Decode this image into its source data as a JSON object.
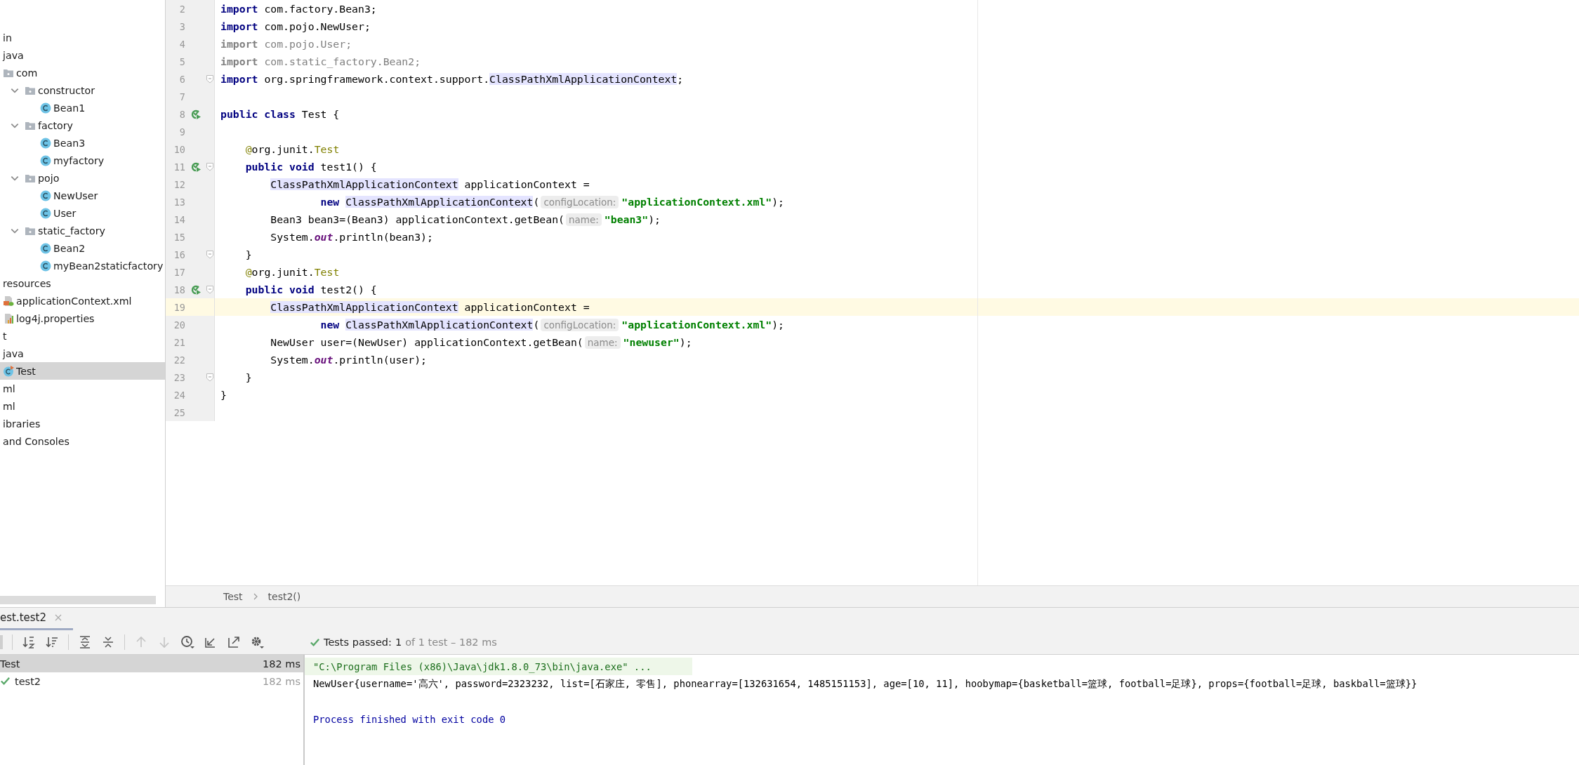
{
  "project_tree": [
    {
      "label": "in",
      "kind": "none",
      "selected": false
    },
    {
      "label": "java",
      "kind": "none",
      "selected": false
    },
    {
      "label": "com",
      "kind": "folder",
      "selected": false,
      "children": [
        {
          "label": "constructor",
          "kind": "folder",
          "selected": false,
          "expanded": true,
          "children": [
            {
              "label": "Bean1",
              "kind": "class",
              "selected": false
            }
          ]
        },
        {
          "label": "factory",
          "kind": "folder",
          "selected": false,
          "expanded": true,
          "children": [
            {
              "label": "Bean3",
              "kind": "class",
              "selected": false
            },
            {
              "label": "myfactory",
              "kind": "class",
              "selected": false
            }
          ]
        },
        {
          "label": "pojo",
          "kind": "folder",
          "selected": false,
          "expanded": true,
          "children": [
            {
              "label": "NewUser",
              "kind": "class",
              "selected": false
            },
            {
              "label": "User",
              "kind": "class",
              "selected": false
            }
          ]
        },
        {
          "label": "static_factory",
          "kind": "folder",
          "selected": false,
          "expanded": true,
          "children": [
            {
              "label": "Bean2",
              "kind": "class",
              "selected": false
            },
            {
              "label": "myBean2staticfactory",
              "kind": "class",
              "selected": false
            }
          ]
        }
      ]
    },
    {
      "label": "resources",
      "kind": "none",
      "selected": false
    },
    {
      "label": "applicationContext.xml",
      "kind": "xml",
      "selected": false
    },
    {
      "label": "log4j.properties",
      "kind": "properties",
      "selected": false
    },
    {
      "label": "t",
      "kind": "none",
      "selected": false
    },
    {
      "label": "java",
      "kind": "none",
      "selected": false
    },
    {
      "label": "Test",
      "kind": "test",
      "selected": true
    },
    {
      "label": "ml",
      "kind": "none",
      "selected": false
    },
    {
      "label": "ml",
      "kind": "none",
      "selected": false
    },
    {
      "label": "ibraries",
      "kind": "none",
      "selected": false
    },
    {
      "label": "and Consoles",
      "kind": "none",
      "selected": false
    }
  ],
  "editor": {
    "lines": [
      {
        "number": "2",
        "current": false,
        "run": false,
        "fold": false,
        "tokens": [
          {
            "kind": "keyword",
            "text": "import"
          },
          {
            "kind": "plain",
            "text": " com.factory.Bean3;"
          }
        ]
      },
      {
        "number": "3",
        "current": false,
        "run": false,
        "fold": false,
        "tokens": [
          {
            "kind": "keyword",
            "text": "import"
          },
          {
            "kind": "plain",
            "text": " com.pojo.NewUser;"
          }
        ]
      },
      {
        "number": "4",
        "current": false,
        "run": false,
        "fold": false,
        "tokens": [
          {
            "kind": "unused_keyword",
            "text": "import"
          },
          {
            "kind": "unused",
            "text": " com.pojo.User;"
          }
        ]
      },
      {
        "number": "5",
        "current": false,
        "run": false,
        "fold": false,
        "tokens": [
          {
            "kind": "unused_keyword",
            "text": "import"
          },
          {
            "kind": "unused",
            "text": " com.static_factory.Bean2;"
          }
        ]
      },
      {
        "number": "6",
        "current": false,
        "run": false,
        "fold": true,
        "tokens": [
          {
            "kind": "keyword",
            "text": "import"
          },
          {
            "kind": "plain",
            "text": " org.springframework.context.support."
          },
          {
            "kind": "ref",
            "text": "ClassPathXmlApplicationContext"
          },
          {
            "kind": "plain",
            "text": ";"
          }
        ]
      },
      {
        "number": "7",
        "current": false,
        "run": false,
        "fold": false
      },
      {
        "number": "8",
        "current": false,
        "run": true,
        "fold": false,
        "tokens": [
          {
            "kind": "keyword",
            "text": "public class"
          },
          {
            "kind": "plain",
            "text": " Test {"
          }
        ]
      },
      {
        "number": "9",
        "current": false,
        "run": false,
        "fold": false
      },
      {
        "number": "10",
        "current": false,
        "run": false,
        "fold": false,
        "tokens": [
          {
            "kind": "annotation",
            "text": "    @"
          },
          {
            "kind": "plain",
            "text": "org.junit."
          },
          {
            "kind": "annotation",
            "text": "Test"
          }
        ]
      },
      {
        "number": "11",
        "current": false,
        "run": true,
        "fold": true,
        "tokens": [
          {
            "kind": "keyword",
            "text": "    public void"
          },
          {
            "kind": "plain",
            "text": " test1() {"
          }
        ]
      },
      {
        "number": "12",
        "current": false,
        "run": false,
        "fold": false,
        "tokens": [
          {
            "kind": "ref",
            "text": "        ClassPathXmlApplicationContext"
          },
          {
            "kind": "plain",
            "text": " applicationContext ="
          }
        ]
      },
      {
        "number": "13",
        "current": false,
        "run": false,
        "fold": false,
        "tokens": [
          {
            "kind": "keyword",
            "text": "                new "
          },
          {
            "kind": "ref",
            "text": "ClassPathXmlApplicationContext"
          },
          {
            "kind": "plain",
            "text": "("
          },
          {
            "kind": "hint",
            "text": "configLocation:"
          },
          {
            "kind": "string",
            "text": "\"applicationContext.xml\""
          },
          {
            "kind": "plain",
            "text": ");"
          }
        ]
      },
      {
        "number": "14",
        "current": false,
        "run": false,
        "fold": false,
        "tokens": [
          {
            "kind": "plain",
            "text": "        Bean3 bean3=(Bean3) applicationContext.getBean("
          },
          {
            "kind": "hint",
            "text": "name:"
          },
          {
            "kind": "string",
            "text": "\"bean3\""
          },
          {
            "kind": "plain",
            "text": ");"
          }
        ]
      },
      {
        "number": "15",
        "current": false,
        "run": false,
        "fold": false,
        "tokens": [
          {
            "kind": "plain",
            "text": "        System."
          },
          {
            "kind": "static",
            "text": "out"
          },
          {
            "kind": "plain",
            "text": ".println(bean3);"
          }
        ]
      },
      {
        "number": "16",
        "current": false,
        "run": false,
        "fold": true,
        "tokens": [
          {
            "kind": "plain",
            "text": "    }"
          }
        ]
      },
      {
        "number": "17",
        "current": false,
        "run": false,
        "fold": false,
        "tokens": [
          {
            "kind": "annotation",
            "text": "    @"
          },
          {
            "kind": "plain",
            "text": "org.junit."
          },
          {
            "kind": "annotation",
            "text": "Test"
          }
        ]
      },
      {
        "number": "18",
        "current": false,
        "run": true,
        "fold": true,
        "tokens": [
          {
            "kind": "keyword",
            "text": "    public void"
          },
          {
            "kind": "plain",
            "text": " test2() {"
          }
        ]
      },
      {
        "number": "19",
        "current": true,
        "run": false,
        "fold": false,
        "tokens": [
          {
            "kind": "ref",
            "text": "        ClassPathXmlApplicationContext"
          },
          {
            "kind": "plain",
            "text": " applicationContext ="
          }
        ]
      },
      {
        "number": "20",
        "current": false,
        "run": false,
        "fold": false,
        "tokens": [
          {
            "kind": "keyword",
            "text": "                new "
          },
          {
            "kind": "ref",
            "text": "ClassPathXmlApplicationContext"
          },
          {
            "kind": "plain",
            "text": "("
          },
          {
            "kind": "hint",
            "text": "configLocation:"
          },
          {
            "kind": "string",
            "text": "\"applicationContext.xml\""
          },
          {
            "kind": "plain",
            "text": ");"
          }
        ]
      },
      {
        "number": "21",
        "current": false,
        "run": false,
        "fold": false,
        "tokens": [
          {
            "kind": "plain",
            "text": "        NewUser user=(NewUser) applicationContext.getBean("
          },
          {
            "kind": "hint",
            "text": "name:"
          },
          {
            "kind": "string",
            "text": "\"newuser\""
          },
          {
            "kind": "plain",
            "text": ");"
          }
        ]
      },
      {
        "number": "22",
        "current": false,
        "run": false,
        "fold": false,
        "tokens": [
          {
            "kind": "plain",
            "text": "        System."
          },
          {
            "kind": "static",
            "text": "out"
          },
          {
            "kind": "plain",
            "text": ".println(user);"
          }
        ]
      },
      {
        "number": "23",
        "current": false,
        "run": false,
        "fold": true,
        "tokens": [
          {
            "kind": "plain",
            "text": "    }"
          }
        ]
      },
      {
        "number": "24",
        "current": false,
        "run": false,
        "fold": false,
        "tokens": [
          {
            "kind": "plain",
            "text": "}"
          }
        ]
      },
      {
        "number": "25",
        "current": false,
        "run": false,
        "fold": false
      }
    ],
    "breadcrumb": [
      "Test",
      "test2()"
    ]
  },
  "run_panel": {
    "tab": "est.test2",
    "status": {
      "label": "Tests passed:",
      "count": "1",
      "detail": "of 1 test – 182 ms"
    },
    "tests": [
      {
        "kind": "suite",
        "name": "Test",
        "time": "182 ms",
        "selected": true
      },
      {
        "kind": "test",
        "name": "test2",
        "time": "182 ms",
        "selected": false
      }
    ],
    "console": [
      {
        "kind": "command",
        "text": "\"C:\\Program Files (x86)\\Java\\jdk1.8.0_73\\bin\\java.exe\" ..."
      },
      {
        "kind": "output",
        "text": "NewUser{username='高六', password=2323232, list=[石家庄, 零售], phonearray=[132631654, 1485151153], age=[10, 11], hoobymap={basketball=篮球, football=足球}, props={football=足球, baskball=篮球}}"
      },
      {
        "kind": "exit",
        "text": "Process finished with exit code 0"
      }
    ]
  }
}
